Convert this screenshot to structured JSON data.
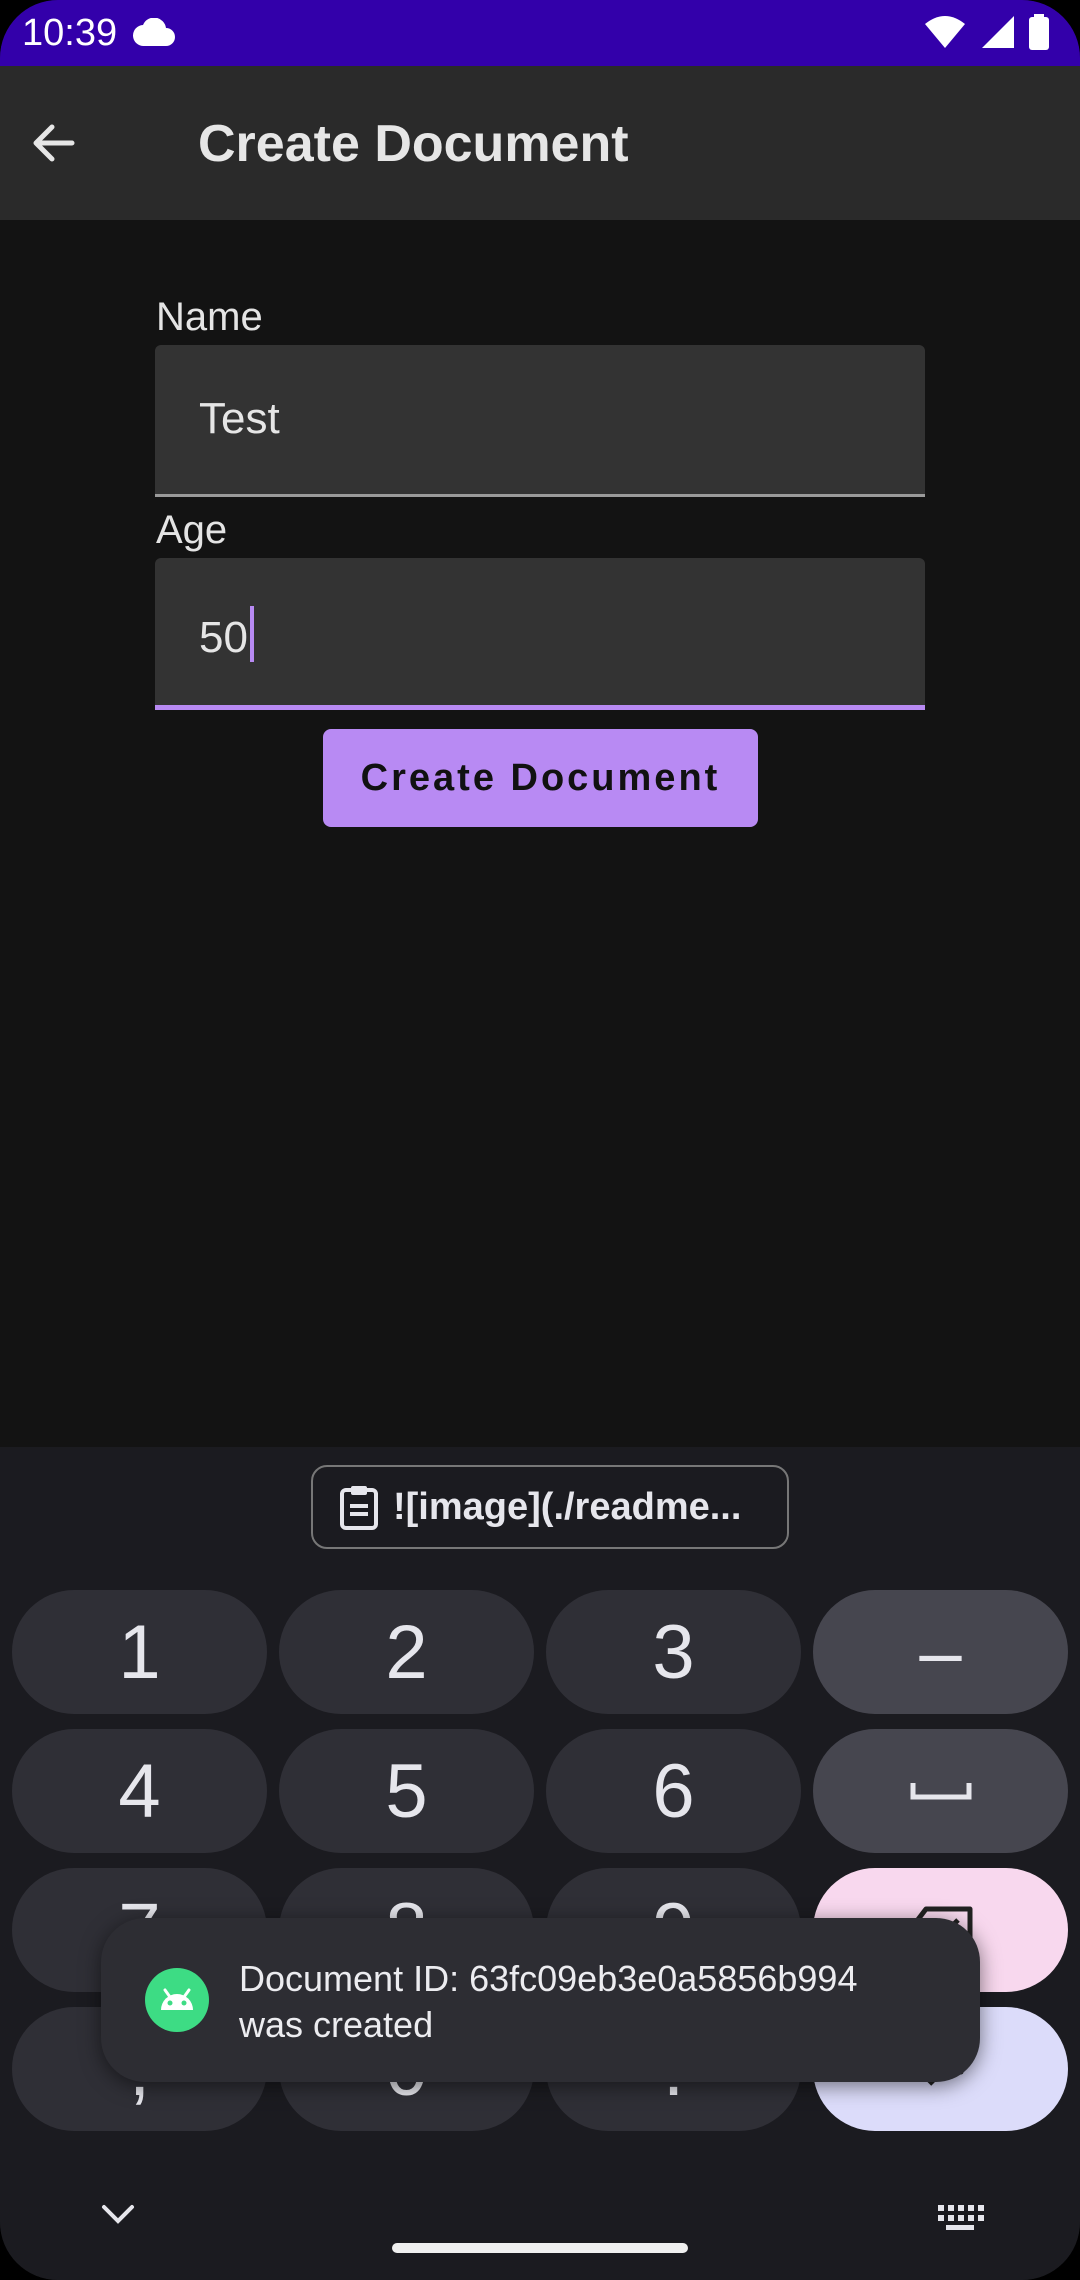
{
  "status_bar": {
    "time": "10:39"
  },
  "app_bar": {
    "title": "Create Document"
  },
  "form": {
    "name_label": "Name",
    "name_value": "Test",
    "age_label": "Age",
    "age_value": "50",
    "submit_label": "Create Document"
  },
  "keyboard": {
    "clipboard_chip": "![image](./readme...",
    "keys": [
      "1",
      "2",
      "3",
      "–",
      "4",
      "5",
      "6",
      "␣",
      "7",
      "8",
      "9",
      "⌫",
      ",",
      "0",
      ".",
      "↵"
    ]
  },
  "toast": {
    "line1": "Document ID: 63fc09eb3e0a5856b994",
    "line2": "was created"
  },
  "colors": {
    "status_bar": "#3300aa",
    "accent": "#b88af3",
    "background": "#131313",
    "toast_icon": "#3ddc84"
  }
}
